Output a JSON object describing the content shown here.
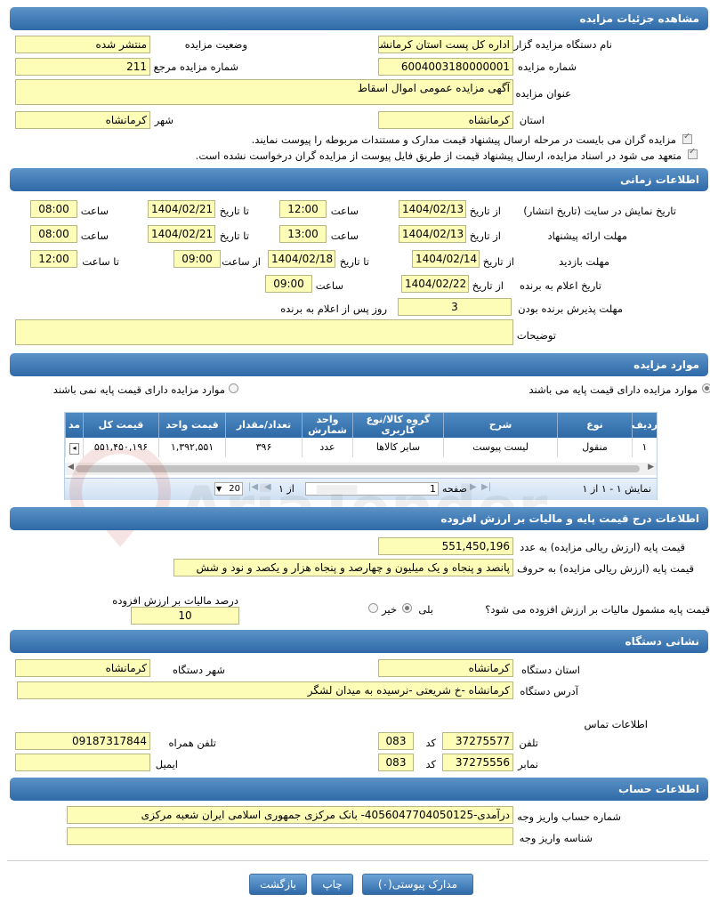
{
  "sections": {
    "details": "مشاهده جزئیات مزایده",
    "timing": "اطلاعات زمانی",
    "items": "موارد مزایده",
    "price": "اطلاعات درج قیمت پایه و مالیات بر ارزش افزوده",
    "org": "نشانی دستگاه",
    "account": "اطلاعات حساب"
  },
  "details": {
    "org_label": "نام دستگاه مزایده گزار",
    "org_value": "اداره کل پست استان کرمانشاه",
    "status_label": "وضعیت مزایده",
    "status_value": "منتشر شده",
    "number_label": "شماره مزایده",
    "number_value": "6004003180000001",
    "ref_label": "شماره مزایده مرجع",
    "ref_value": "211",
    "title_label": "عنوان مزایده",
    "title_value": "آگهی مزایده عمومی اموال اسقاط",
    "province_label": "استان",
    "province_value": "کرمانشاه",
    "city_label": "شهر",
    "city_value": "کرمانشاه",
    "check1": "مزایده گران می بایست در مرحله ارسال پیشنهاد قیمت مدارک و مستندات مربوطه را پیوست نمایند.",
    "check2": "متعهد می شود در اسناد مزایده، ارسال پیشنهاد قیمت از طریق فایل پیوست از مزایده گران درخواست نشده است."
  },
  "timing": {
    "from_date": "از تاریخ",
    "to_date": "تا تاریخ",
    "time": "ساعت",
    "to_time": "تا ساعت",
    "from_time": "از ساعت",
    "display_label": "تاریخ نمایش در سایت (تاریخ انتشار)",
    "display_from": "1404/02/13",
    "display_from_time": "12:00",
    "display_to": "1404/02/21",
    "display_to_time": "08:00",
    "offer_label": "مهلت ارائه پیشنهاد",
    "offer_from": "1404/02/13",
    "offer_from_time": "13:00",
    "offer_to": "1404/02/21",
    "offer_to_time": "08:00",
    "visit_label": "مهلت بازدید",
    "visit_from": "1404/02/14",
    "visit_to": "1404/02/18",
    "visit_from_time": "09:00",
    "visit_to_time": "12:00",
    "announce_label": "تاریخ اعلام به برنده",
    "announce_from": "1404/02/22",
    "announce_time": "09:00",
    "accept_label": "مهلت پذیرش برنده بودن",
    "accept_value": "3",
    "accept_suffix": "روز پس از اعلام به برنده",
    "desc_label": "توضیحات"
  },
  "items": {
    "radio_with": "موارد مزایده دارای قیمت پایه می باشند",
    "radio_without": "موارد مزایده دارای قیمت پایه نمی باشند",
    "headers": [
      "ردیف",
      "نوع",
      "شرح",
      "گروه کالا/نوع کاربری",
      "واحد شمارش",
      "تعداد/مقدار",
      "قیمت واحد",
      "قیمت کل",
      "مد"
    ],
    "rows": [
      [
        "۱",
        "منقول",
        "لیست پیوست",
        "سایر کالاها",
        "عدد",
        "۳۹۶",
        "۱,۳۹۲,۵۵۱",
        "۵۵۱,۴۵۰,۱۹۶",
        ""
      ]
    ],
    "pager_info": "نمایش ۱ - ۱ از ۱",
    "page_label": "صفحه",
    "page_value": "1",
    "of_label": "از ۱",
    "page_size": "20"
  },
  "price": {
    "base_num_label": "قیمت پایه (ارزش ریالی مزایده) به عدد",
    "base_num_value": "551,450,196",
    "base_words_label": "قیمت پایه (ارزش ریالی مزایده) به حروف",
    "base_words_value": "پانصد و پنجاه و یک میلیون و چهارصد و پنجاه هزار و یکصد و نود و شش",
    "vat_question": "قیمت پایه مشمول مالیات بر ارزش افزوده می شود؟",
    "yes": "بلی",
    "no": "خیر",
    "vat_percent_label": "درصد مالیات بر ارزش افزوده",
    "vat_percent_value": "10"
  },
  "org": {
    "province_label": "استان دستگاه",
    "province_value": "کرمانشاه",
    "city_label": "شهر دستگاه",
    "city_value": "کرمانشاه",
    "address_label": "آدرس دستگاه",
    "address_value": "کرمانشاه -خ شریعتی -نرسیده به میدان لشگر",
    "contact_label": "اطلاعات تماس",
    "phone_label": "تلفن",
    "phone_value": "37275577",
    "code_label": "کد",
    "phone_code": "083",
    "mobile_label": "تلفن همراه",
    "mobile_value": "09187317844",
    "fax_label": "نمابر",
    "fax_value": "37275556",
    "fax_code": "083",
    "email_label": "ایمیل",
    "email_value": ""
  },
  "account": {
    "acc_label": "شماره حساب واریز وجه",
    "acc_value": "درآمدی-405604770405012‌5- بانک مرکزی جمهوری اسلامی ایران شعبه مرکزی",
    "id_label": "شناسه واریز وجه",
    "id_value": ""
  },
  "buttons": {
    "attachments": "مدارک پیوستی(۰)",
    "print": "چاپ",
    "back": "بازگشت"
  },
  "watermark": "AriaTender.neT"
}
